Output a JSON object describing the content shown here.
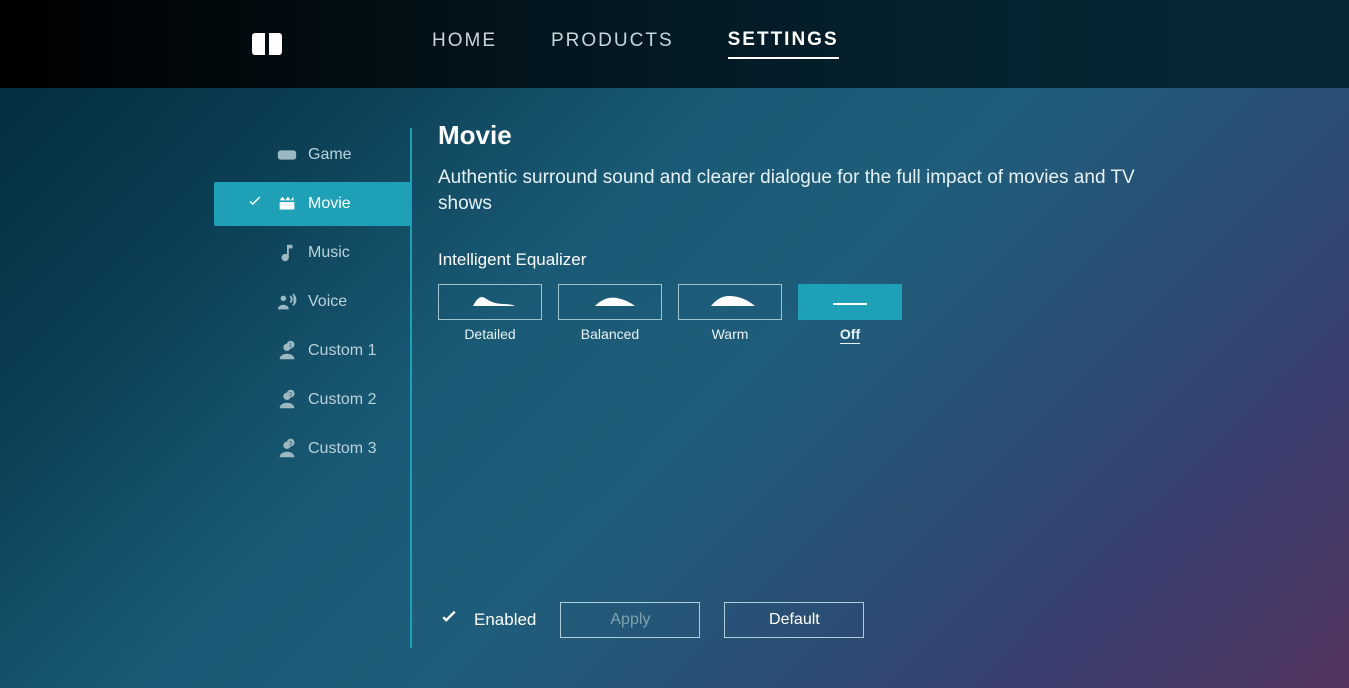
{
  "nav": {
    "items": [
      {
        "label": "HOME",
        "active": false
      },
      {
        "label": "PRODUCTS",
        "active": false
      },
      {
        "label": "SETTINGS",
        "active": true
      }
    ]
  },
  "sidebar": {
    "items": [
      {
        "label": "Game",
        "icon": "gamepad-icon",
        "active": false
      },
      {
        "label": "Movie",
        "icon": "movie-icon",
        "active": true
      },
      {
        "label": "Music",
        "icon": "music-icon",
        "active": false
      },
      {
        "label": "Voice",
        "icon": "voice-icon",
        "active": false
      },
      {
        "label": "Custom 1",
        "icon": "custom1-icon",
        "active": false
      },
      {
        "label": "Custom 2",
        "icon": "custom2-icon",
        "active": false
      },
      {
        "label": "Custom 3",
        "icon": "custom3-icon",
        "active": false
      }
    ]
  },
  "content": {
    "title": "Movie",
    "description": "Authentic surround sound and clearer dialogue for the full impact of movies and TV shows",
    "equalizer": {
      "label": "Intelligent Equalizer",
      "options": [
        {
          "label": "Detailed",
          "selected": false
        },
        {
          "label": "Balanced",
          "selected": false
        },
        {
          "label": "Warm",
          "selected": false
        },
        {
          "label": "Off",
          "selected": true
        }
      ]
    }
  },
  "footer": {
    "enabled_label": "Enabled",
    "enabled_checked": true,
    "apply_label": "Apply",
    "default_label": "Default"
  }
}
